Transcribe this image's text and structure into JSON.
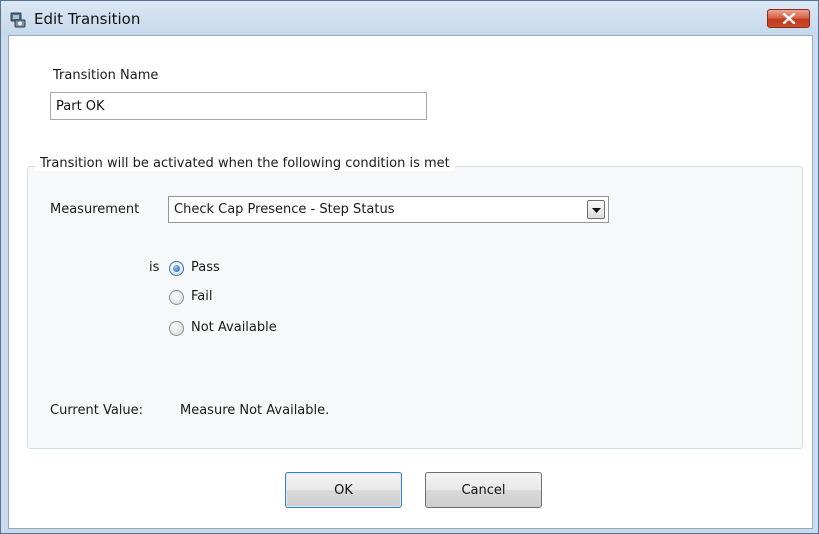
{
  "window": {
    "title": "Edit Transition",
    "icon": "app-icon",
    "close_icon": "close-icon"
  },
  "transition_name": {
    "label": "Transition Name",
    "value": "Part OK"
  },
  "condition_group": {
    "legend": "Transition will be activated when the following condition is met",
    "measurement_label": "Measurement",
    "measurement_value": "Check Cap Presence - Step Status",
    "is_label": "is",
    "options": [
      {
        "label": "Pass",
        "checked": true
      },
      {
        "label": "Fail",
        "checked": false
      },
      {
        "label": "Not Available",
        "checked": false
      }
    ],
    "current_value_label": "Current Value:",
    "current_value": "Measure Not Available."
  },
  "buttons": {
    "ok": "OK",
    "cancel": "Cancel"
  }
}
